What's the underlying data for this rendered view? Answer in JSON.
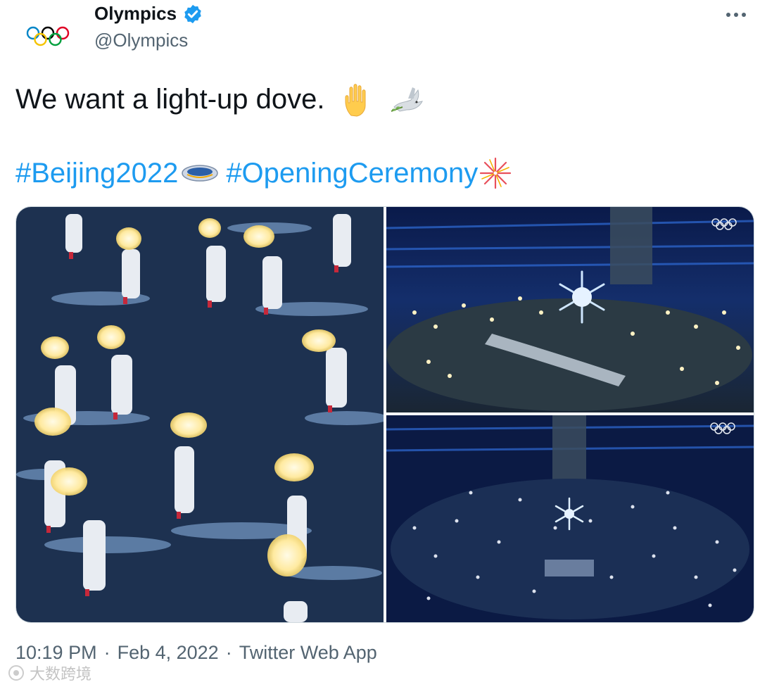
{
  "author": {
    "display_name": "Olympics",
    "handle": "@Olympics",
    "verified_icon": "verified-badge-icon",
    "avatar_icon": "olympic-rings-icon"
  },
  "tweet": {
    "text": "We want a light-up dove.",
    "emojis": [
      "raised-hand-icon",
      "dove-icon"
    ],
    "hashtags": [
      {
        "label": "#Beijing2022",
        "icon": "beijing2022-flag-icon"
      },
      {
        "label": "#OpeningCeremony",
        "icon": "fireworks-icon"
      }
    ]
  },
  "media": {
    "photos": [
      {
        "icon": "dancers-with-doves-photo"
      },
      {
        "icon": "stadium-snowflake-photo"
      },
      {
        "icon": "stadium-crowd-photo"
      }
    ],
    "overlay_icon": "olympic-rings-icon"
  },
  "meta": {
    "time": "10:19 PM",
    "date": "Feb 4, 2022",
    "source": "Twitter Web App",
    "separator": "·"
  },
  "watermark": {
    "text": "大数跨境"
  },
  "colors": {
    "link": "#1d9bf0",
    "text": "#0f1419",
    "secondary": "#536471",
    "verified": "#1d9bf0"
  }
}
